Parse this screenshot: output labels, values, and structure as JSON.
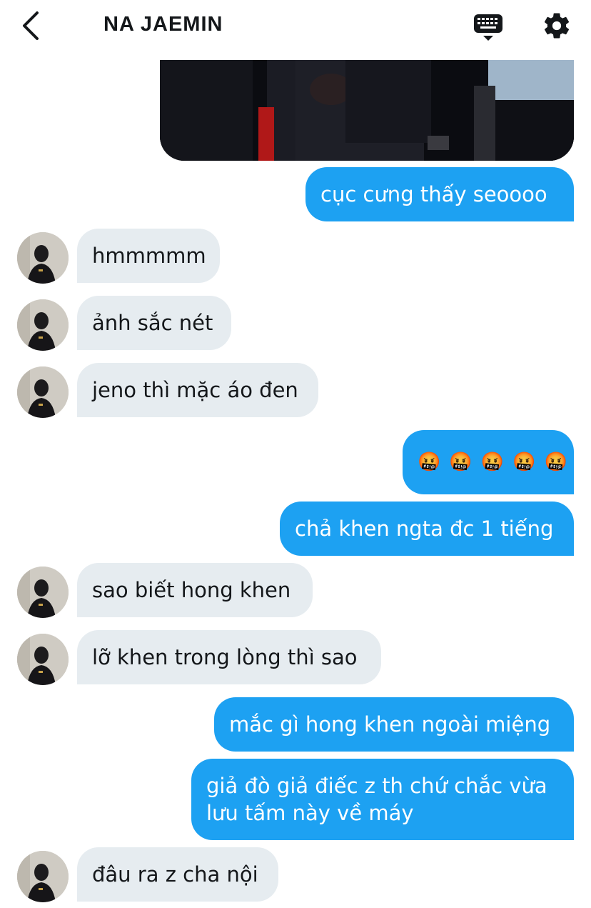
{
  "header": {
    "title": "NA JAEMIN",
    "back_icon": "chevron-left-icon",
    "keyboard_icon": "keyboard-icon",
    "settings_icon": "gear-icon"
  },
  "messages": [
    {
      "from": "me",
      "type": "image"
    },
    {
      "from": "me",
      "text": "cục cưng thấy seoooo"
    },
    {
      "from": "them",
      "text": "hmmmmm"
    },
    {
      "from": "them",
      "text": "ảnh sắc nét"
    },
    {
      "from": "them",
      "text": "jeno thì mặc áo đen"
    },
    {
      "from": "me",
      "emoji": [
        "🤬",
        "🤬",
        "🤬",
        "🤬",
        "🤬"
      ]
    },
    {
      "from": "me",
      "text": "chả khen ngta đc 1 tiếng"
    },
    {
      "from": "them",
      "text": "sao biết hong khen"
    },
    {
      "from": "them",
      "text": "lỡ khen trong lòng thì sao"
    },
    {
      "from": "me",
      "text": "mắc gì hong khen ngoài miệng"
    },
    {
      "from": "me",
      "text": "giả đò giả điếc z th chứ chắc vừa lưu tấm này về máy"
    },
    {
      "from": "them",
      "text": "đâu ra z cha nội"
    }
  ],
  "colors": {
    "sent_bubble": "#1da1f2",
    "received_bubble": "#e6ecf0",
    "text": "#14171a"
  }
}
